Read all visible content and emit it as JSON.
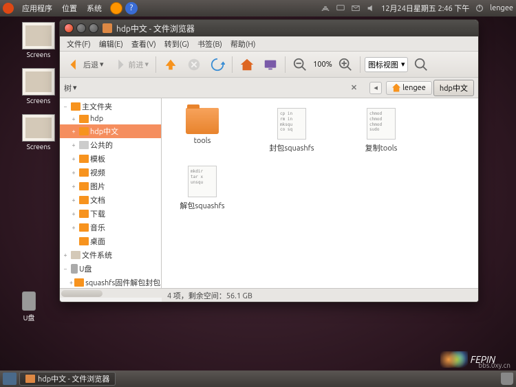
{
  "top_panel": {
    "menus": [
      "应用程序",
      "位置",
      "系统"
    ],
    "datetime": "12月24日星期五  2:46 下午",
    "user": "lengee"
  },
  "desktop": {
    "icons": [
      {
        "label": "Screens"
      },
      {
        "label": "Screens"
      },
      {
        "label": "Screens"
      }
    ],
    "usb_label": "U盘"
  },
  "window": {
    "title": "hdp中文 - 文件浏览器",
    "menubar": [
      "文件(F)",
      "编辑(E)",
      "查看(V)",
      "转到(G)",
      "书签(B)",
      "帮助(H)"
    ],
    "toolbar": {
      "back": "后退",
      "forward": "前进",
      "zoom": "100%",
      "view_mode": "图标视图"
    },
    "pathbar": {
      "tree_label": "树",
      "crumbs": [
        "lengee",
        "hdp中文"
      ]
    },
    "sidebar": [
      {
        "exp": "−",
        "icon": "home",
        "label": "主文件夹",
        "indent": 0
      },
      {
        "exp": "+",
        "icon": "folder",
        "label": "hdp",
        "indent": 1
      },
      {
        "exp": "+",
        "icon": "folder",
        "label": "hdp中文",
        "indent": 1,
        "selected": true
      },
      {
        "exp": "+",
        "icon": "disabled",
        "label": "公共的",
        "indent": 1
      },
      {
        "exp": "+",
        "icon": "folder",
        "label": "模板",
        "indent": 1
      },
      {
        "exp": "+",
        "icon": "folder",
        "label": "视频",
        "indent": 1
      },
      {
        "exp": "+",
        "icon": "folder",
        "label": "图片",
        "indent": 1
      },
      {
        "exp": "+",
        "icon": "folder",
        "label": "文档",
        "indent": 1
      },
      {
        "exp": "+",
        "icon": "folder",
        "label": "下载",
        "indent": 1
      },
      {
        "exp": "+",
        "icon": "folder",
        "label": "音乐",
        "indent": 1
      },
      {
        "exp": "",
        "icon": "folder",
        "label": "桌面",
        "indent": 1
      },
      {
        "exp": "+",
        "icon": "fs",
        "label": "文件系统",
        "indent": 0
      },
      {
        "exp": "−",
        "icon": "usb",
        "label": "U盘",
        "indent": 0
      },
      {
        "exp": "+",
        "icon": "folder",
        "label": "squashfs固件解包封包",
        "indent": 1
      }
    ],
    "files": [
      {
        "type": "folder",
        "name": "tools"
      },
      {
        "type": "script",
        "name": "封包squashfs",
        "preview": "cp in\nrm in\nmksqu\nco sq"
      },
      {
        "type": "script",
        "name": "复制tools",
        "preview": "chmod\nchmod\nchmod\nsudo"
      },
      {
        "type": "script",
        "name": "解包squashfs",
        "preview": "mkdir\ntar x\nunsqu"
      }
    ],
    "status": "4 项，剩余空间：56.1 GB"
  },
  "taskbar": {
    "task": "hdp中文 - 文件浏览器"
  },
  "watermark": "bbs.0xy.cn",
  "logo_text": "FEPIN"
}
